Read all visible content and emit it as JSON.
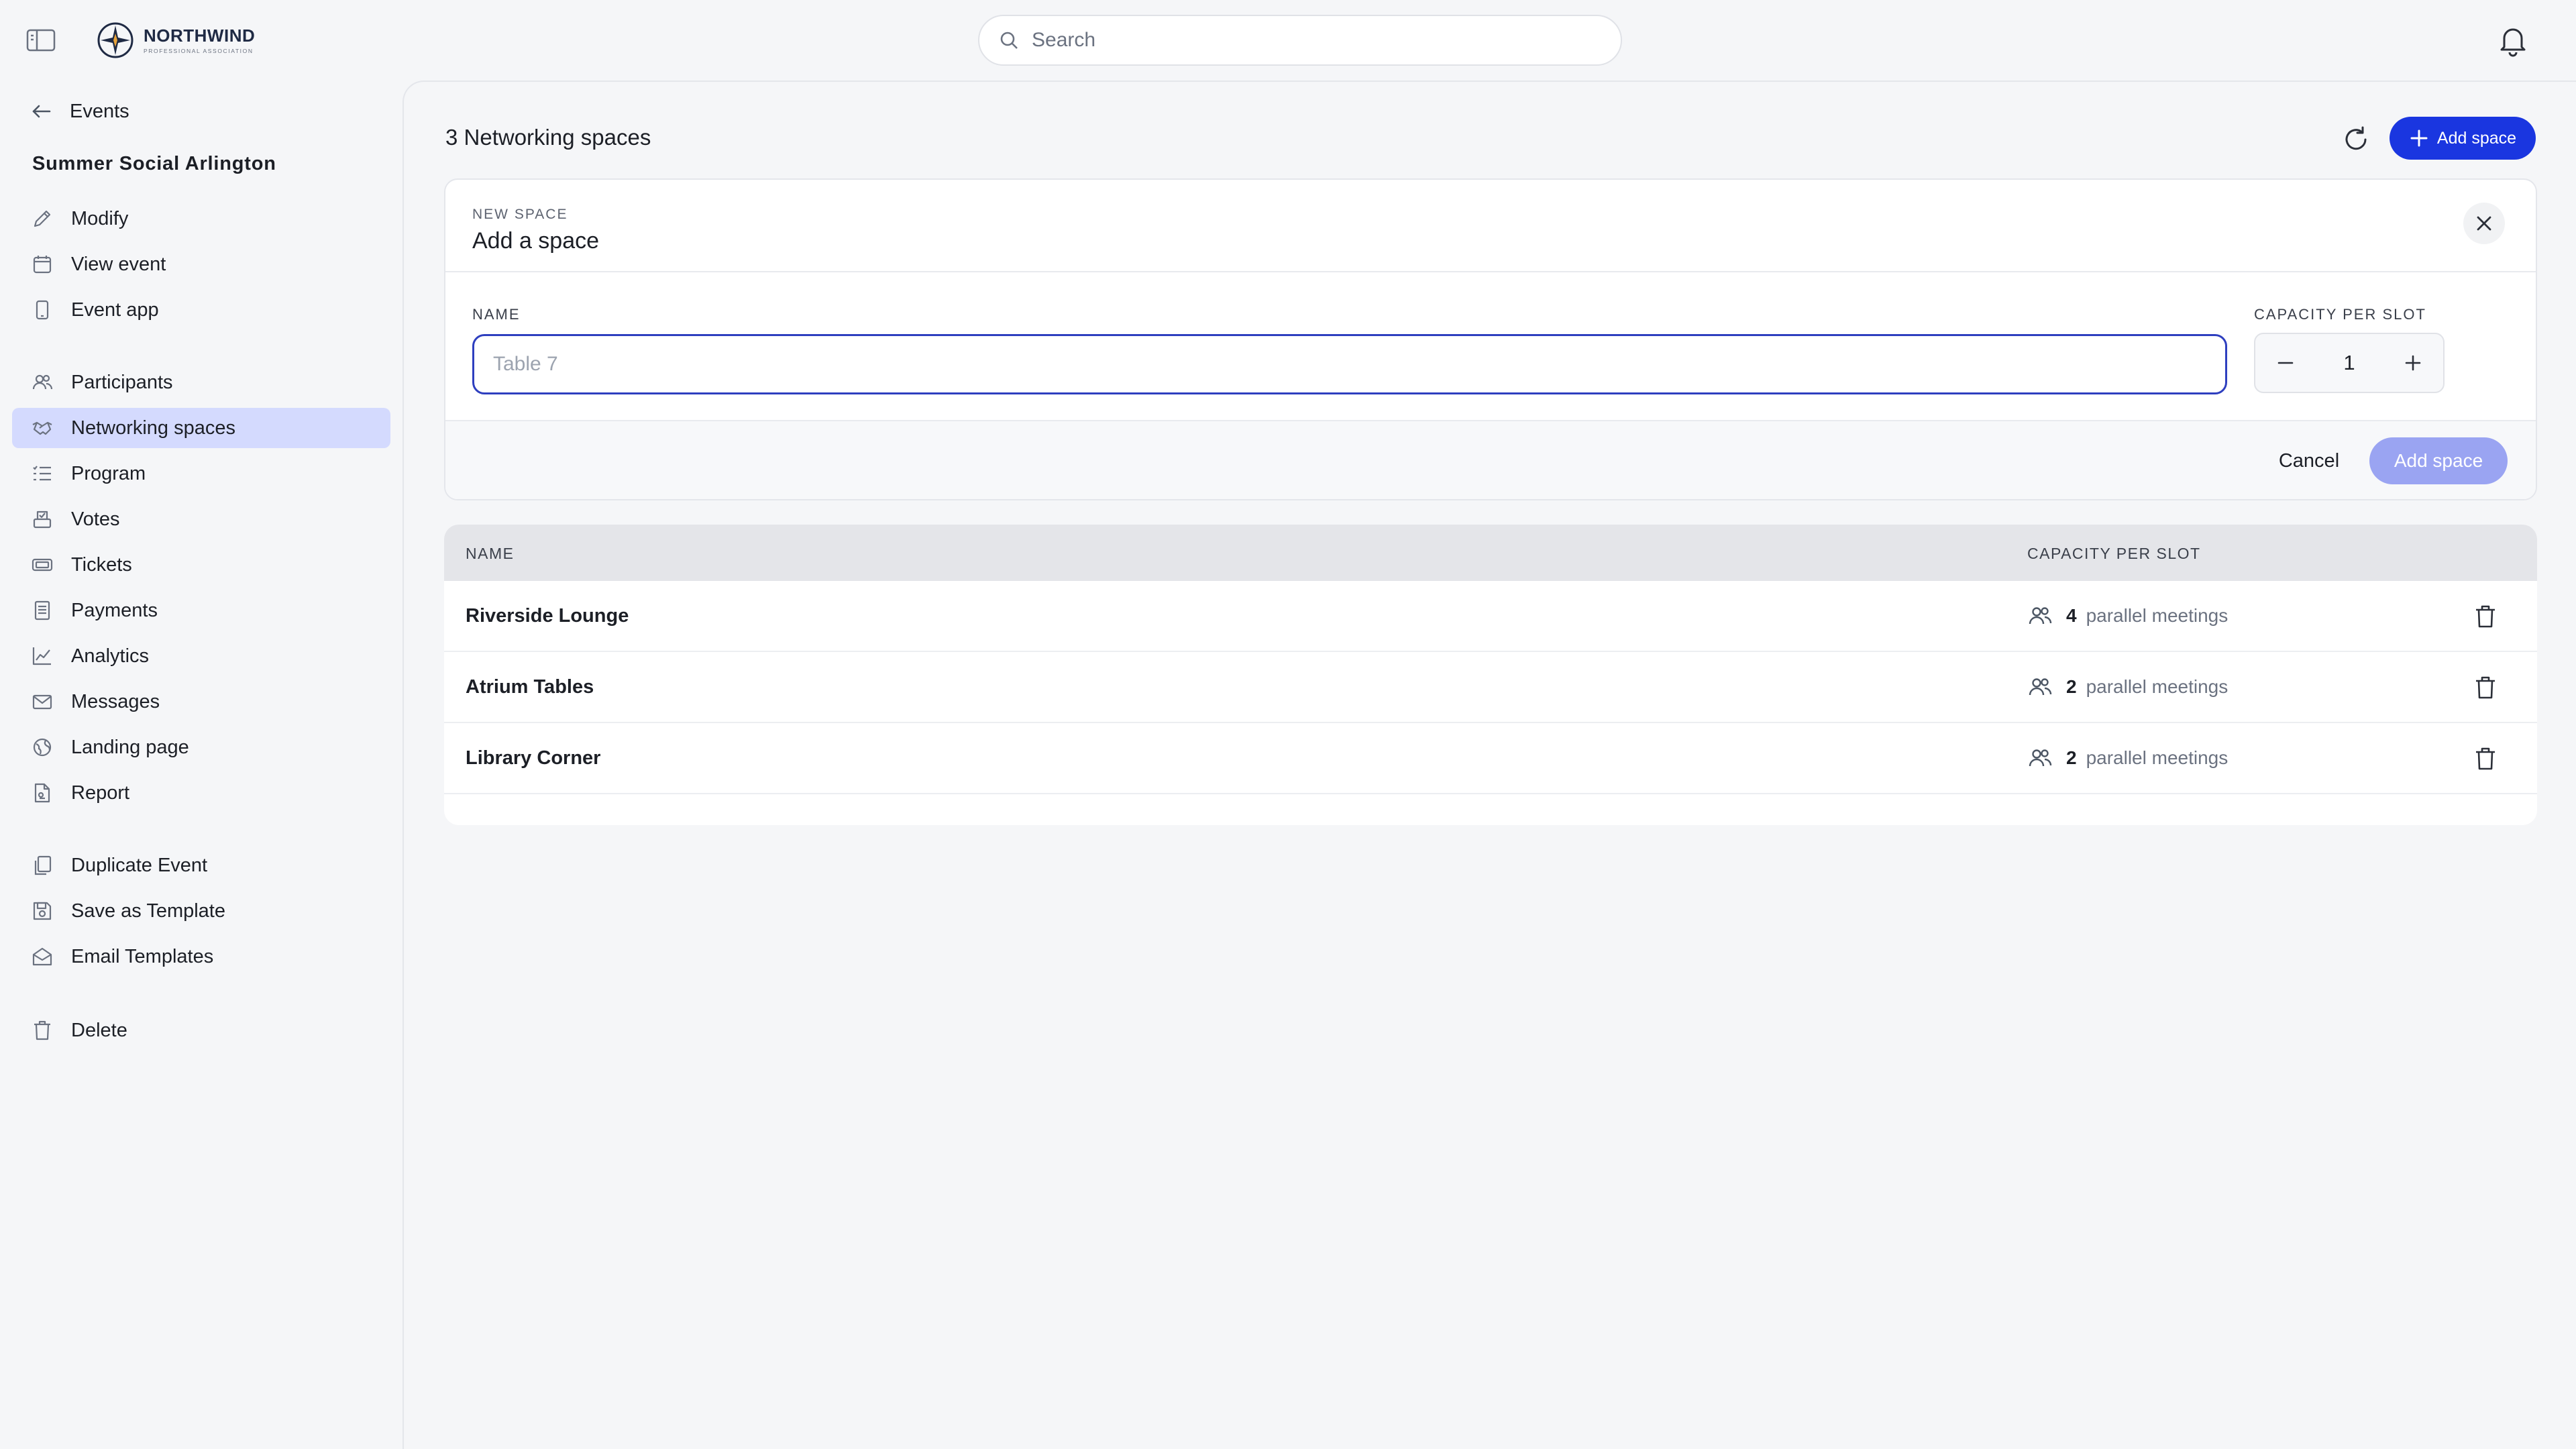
{
  "header": {
    "logo": {
      "name": "NORTHWIND",
      "tagline": "PROFESSIONAL ASSOCIATION"
    },
    "search": {
      "placeholder": "Search",
      "value": ""
    }
  },
  "sidebar": {
    "back_label": "Events",
    "event_title": "Summer Social Arlington",
    "groups": [
      [
        {
          "label": "Modify",
          "icon": "pencil-icon"
        },
        {
          "label": "View event",
          "icon": "calendar-icon"
        },
        {
          "label": "Event app",
          "icon": "phone-icon"
        }
      ],
      [
        {
          "label": "Participants",
          "icon": "users-icon"
        },
        {
          "label": "Networking spaces",
          "icon": "handshake-icon",
          "active": true
        },
        {
          "label": "Program",
          "icon": "list-icon"
        },
        {
          "label": "Votes",
          "icon": "ballot-icon"
        },
        {
          "label": "Tickets",
          "icon": "ticket-icon"
        },
        {
          "label": "Payments",
          "icon": "receipt-icon"
        },
        {
          "label": "Analytics",
          "icon": "chart-icon"
        },
        {
          "label": "Messages",
          "icon": "mail-icon"
        },
        {
          "label": "Landing page",
          "icon": "globe-icon"
        },
        {
          "label": "Report",
          "icon": "report-icon"
        }
      ],
      [
        {
          "label": "Duplicate Event",
          "icon": "copy-icon"
        },
        {
          "label": "Save as Template",
          "icon": "save-icon"
        },
        {
          "label": "Email Templates",
          "icon": "mail-open-icon"
        }
      ],
      [
        {
          "label": "Delete",
          "icon": "trash-icon"
        }
      ]
    ]
  },
  "main": {
    "title": "3 Networking spaces",
    "add_button_label": "Add space",
    "new_space": {
      "eyebrow": "NEW SPACE",
      "title": "Add a space",
      "name_label": "NAME",
      "name_placeholder": "Table 7",
      "name_value": "",
      "capacity_label": "CAPACITY PER SLOT",
      "capacity_value": "1",
      "cancel_label": "Cancel",
      "submit_label": "Add space"
    },
    "table": {
      "columns": [
        "NAME",
        "CAPACITY PER SLOT"
      ],
      "capacity_suffix": "parallel meetings",
      "rows": [
        {
          "name": "Riverside Lounge",
          "capacity": "4"
        },
        {
          "name": "Atrium Tables",
          "capacity": "2"
        },
        {
          "name": "Library Corner",
          "capacity": "2"
        }
      ]
    }
  },
  "colors": {
    "accent": "#1a36e0",
    "accent_disabled": "#9aa4f2",
    "active_nav": "#d4dafe",
    "page_bg": "#f5f6f8"
  }
}
